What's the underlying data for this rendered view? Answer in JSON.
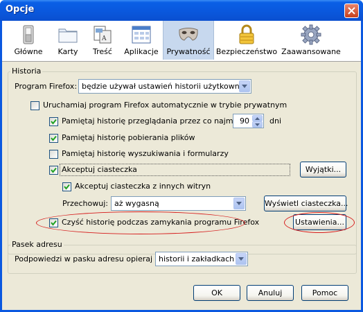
{
  "window": {
    "title": "Opcje"
  },
  "toolbar": {
    "items": [
      {
        "label": "Główne",
        "icon": "switch-icon"
      },
      {
        "label": "Karty",
        "icon": "tabs-folder-icon"
      },
      {
        "label": "Treść",
        "icon": "content-icon"
      },
      {
        "label": "Aplikacje",
        "icon": "applications-icon"
      },
      {
        "label": "Prywatność",
        "icon": "mask-icon"
      },
      {
        "label": "Bezpieczeństwo",
        "icon": "padlock-icon"
      },
      {
        "label": "Zaawansowane",
        "icon": "gear-icon"
      }
    ],
    "selected": "Prywatność"
  },
  "history": {
    "group_title": "Historia",
    "program_label": "Program Firefox:",
    "program_value": "będzie używał ustawień historii użytkownika",
    "private_mode_label": "Uruchamiaj program Firefox automatycznie w trybie prywatnym",
    "private_mode_checked": false,
    "remember_browsing_label": "Pamiętaj historię przeglądania przez co najmniej",
    "remember_browsing_checked": true,
    "days_value": "90",
    "days_unit": "dni",
    "remember_downloads_label": "Pamiętaj historię pobierania plików",
    "remember_downloads_checked": true,
    "remember_search_label": "Pamiętaj historię wyszukiwania i formularzy",
    "remember_search_checked": false,
    "accept_cookies_label": "Akceptuj ciasteczka",
    "accept_cookies_checked": true,
    "exceptions_button": "Wyjątki...",
    "third_party_label": "Akceptuj ciasteczka z innych witryn",
    "third_party_checked": true,
    "keep_label": "Przechowuj:",
    "keep_value": "aż wygasną",
    "show_cookies_button": "Wyświetl ciasteczka...",
    "clear_on_close_label": "Czyść historię podczas zamykania programu Firefox",
    "clear_on_close_checked": true,
    "settings_button": "Ustawienia..."
  },
  "address_bar": {
    "group_title": "Pasek adresu",
    "suggest_label": "Podpowiedzi w pasku adresu opieraj na:",
    "suggest_value": "historii i zakładkach"
  },
  "buttons": {
    "ok": "OK",
    "cancel": "Anuluj",
    "help": "Pomoc"
  },
  "colors": {
    "titlebar": "#0a58e0",
    "client": "#ece9d8",
    "highlight": "#d61a1a",
    "check": "#21a121"
  }
}
